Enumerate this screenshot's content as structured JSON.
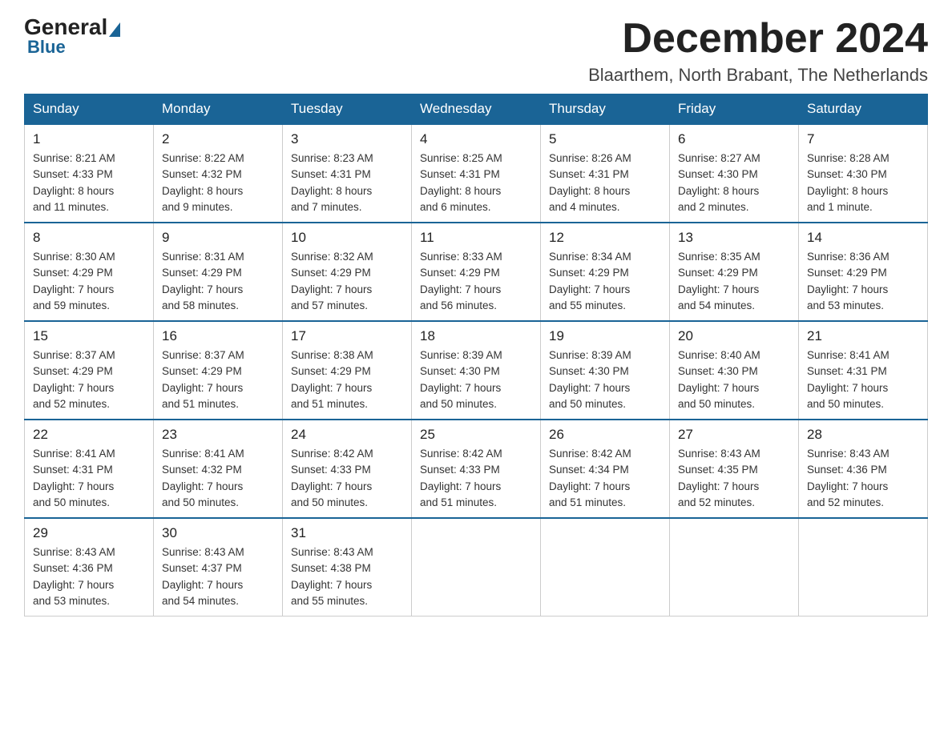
{
  "logo": {
    "general": "General",
    "blue": "Blue"
  },
  "header": {
    "month": "December 2024",
    "location": "Blaarthem, North Brabant, The Netherlands"
  },
  "weekdays": [
    "Sunday",
    "Monday",
    "Tuesday",
    "Wednesday",
    "Thursday",
    "Friday",
    "Saturday"
  ],
  "weeks": [
    [
      {
        "day": "1",
        "info": "Sunrise: 8:21 AM\nSunset: 4:33 PM\nDaylight: 8 hours\nand 11 minutes."
      },
      {
        "day": "2",
        "info": "Sunrise: 8:22 AM\nSunset: 4:32 PM\nDaylight: 8 hours\nand 9 minutes."
      },
      {
        "day": "3",
        "info": "Sunrise: 8:23 AM\nSunset: 4:31 PM\nDaylight: 8 hours\nand 7 minutes."
      },
      {
        "day": "4",
        "info": "Sunrise: 8:25 AM\nSunset: 4:31 PM\nDaylight: 8 hours\nand 6 minutes."
      },
      {
        "day": "5",
        "info": "Sunrise: 8:26 AM\nSunset: 4:31 PM\nDaylight: 8 hours\nand 4 minutes."
      },
      {
        "day": "6",
        "info": "Sunrise: 8:27 AM\nSunset: 4:30 PM\nDaylight: 8 hours\nand 2 minutes."
      },
      {
        "day": "7",
        "info": "Sunrise: 8:28 AM\nSunset: 4:30 PM\nDaylight: 8 hours\nand 1 minute."
      }
    ],
    [
      {
        "day": "8",
        "info": "Sunrise: 8:30 AM\nSunset: 4:29 PM\nDaylight: 7 hours\nand 59 minutes."
      },
      {
        "day": "9",
        "info": "Sunrise: 8:31 AM\nSunset: 4:29 PM\nDaylight: 7 hours\nand 58 minutes."
      },
      {
        "day": "10",
        "info": "Sunrise: 8:32 AM\nSunset: 4:29 PM\nDaylight: 7 hours\nand 57 minutes."
      },
      {
        "day": "11",
        "info": "Sunrise: 8:33 AM\nSunset: 4:29 PM\nDaylight: 7 hours\nand 56 minutes."
      },
      {
        "day": "12",
        "info": "Sunrise: 8:34 AM\nSunset: 4:29 PM\nDaylight: 7 hours\nand 55 minutes."
      },
      {
        "day": "13",
        "info": "Sunrise: 8:35 AM\nSunset: 4:29 PM\nDaylight: 7 hours\nand 54 minutes."
      },
      {
        "day": "14",
        "info": "Sunrise: 8:36 AM\nSunset: 4:29 PM\nDaylight: 7 hours\nand 53 minutes."
      }
    ],
    [
      {
        "day": "15",
        "info": "Sunrise: 8:37 AM\nSunset: 4:29 PM\nDaylight: 7 hours\nand 52 minutes."
      },
      {
        "day": "16",
        "info": "Sunrise: 8:37 AM\nSunset: 4:29 PM\nDaylight: 7 hours\nand 51 minutes."
      },
      {
        "day": "17",
        "info": "Sunrise: 8:38 AM\nSunset: 4:29 PM\nDaylight: 7 hours\nand 51 minutes."
      },
      {
        "day": "18",
        "info": "Sunrise: 8:39 AM\nSunset: 4:30 PM\nDaylight: 7 hours\nand 50 minutes."
      },
      {
        "day": "19",
        "info": "Sunrise: 8:39 AM\nSunset: 4:30 PM\nDaylight: 7 hours\nand 50 minutes."
      },
      {
        "day": "20",
        "info": "Sunrise: 8:40 AM\nSunset: 4:30 PM\nDaylight: 7 hours\nand 50 minutes."
      },
      {
        "day": "21",
        "info": "Sunrise: 8:41 AM\nSunset: 4:31 PM\nDaylight: 7 hours\nand 50 minutes."
      }
    ],
    [
      {
        "day": "22",
        "info": "Sunrise: 8:41 AM\nSunset: 4:31 PM\nDaylight: 7 hours\nand 50 minutes."
      },
      {
        "day": "23",
        "info": "Sunrise: 8:41 AM\nSunset: 4:32 PM\nDaylight: 7 hours\nand 50 minutes."
      },
      {
        "day": "24",
        "info": "Sunrise: 8:42 AM\nSunset: 4:33 PM\nDaylight: 7 hours\nand 50 minutes."
      },
      {
        "day": "25",
        "info": "Sunrise: 8:42 AM\nSunset: 4:33 PM\nDaylight: 7 hours\nand 51 minutes."
      },
      {
        "day": "26",
        "info": "Sunrise: 8:42 AM\nSunset: 4:34 PM\nDaylight: 7 hours\nand 51 minutes."
      },
      {
        "day": "27",
        "info": "Sunrise: 8:43 AM\nSunset: 4:35 PM\nDaylight: 7 hours\nand 52 minutes."
      },
      {
        "day": "28",
        "info": "Sunrise: 8:43 AM\nSunset: 4:36 PM\nDaylight: 7 hours\nand 52 minutes."
      }
    ],
    [
      {
        "day": "29",
        "info": "Sunrise: 8:43 AM\nSunset: 4:36 PM\nDaylight: 7 hours\nand 53 minutes."
      },
      {
        "day": "30",
        "info": "Sunrise: 8:43 AM\nSunset: 4:37 PM\nDaylight: 7 hours\nand 54 minutes."
      },
      {
        "day": "31",
        "info": "Sunrise: 8:43 AM\nSunset: 4:38 PM\nDaylight: 7 hours\nand 55 minutes."
      },
      {
        "day": "",
        "info": ""
      },
      {
        "day": "",
        "info": ""
      },
      {
        "day": "",
        "info": ""
      },
      {
        "day": "",
        "info": ""
      }
    ]
  ]
}
